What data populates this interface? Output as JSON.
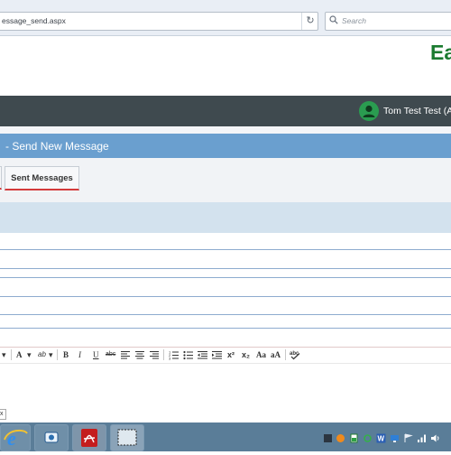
{
  "browser": {
    "url": "essage_send.aspx",
    "search_placeholder": "Search",
    "reload_glyph": "↻"
  },
  "header": {
    "brand": "Ea",
    "brand_color": "#1a7a2f",
    "user_name": "Tom Test Test (As"
  },
  "page": {
    "title": "- Send New Message"
  },
  "tabs": {
    "sent_messages": "Sent Messages"
  },
  "editor": {
    "toolbar": {
      "dropdown_arrow": "▾",
      "font_color": "A",
      "highlight": "ab",
      "bold": "B",
      "italic": "I",
      "underline": "U",
      "strike": "abc",
      "superscript": "x²",
      "subscript": "x₂",
      "case_title": "Aa",
      "case_upper": "aA"
    }
  },
  "bottom_tab": {
    "label": "x"
  },
  "colors": {
    "topnav": "#3f4a4f",
    "title_bar": "#6a9fcf",
    "accent_red": "#d43b3b",
    "taskbar": "#5a7d98"
  }
}
